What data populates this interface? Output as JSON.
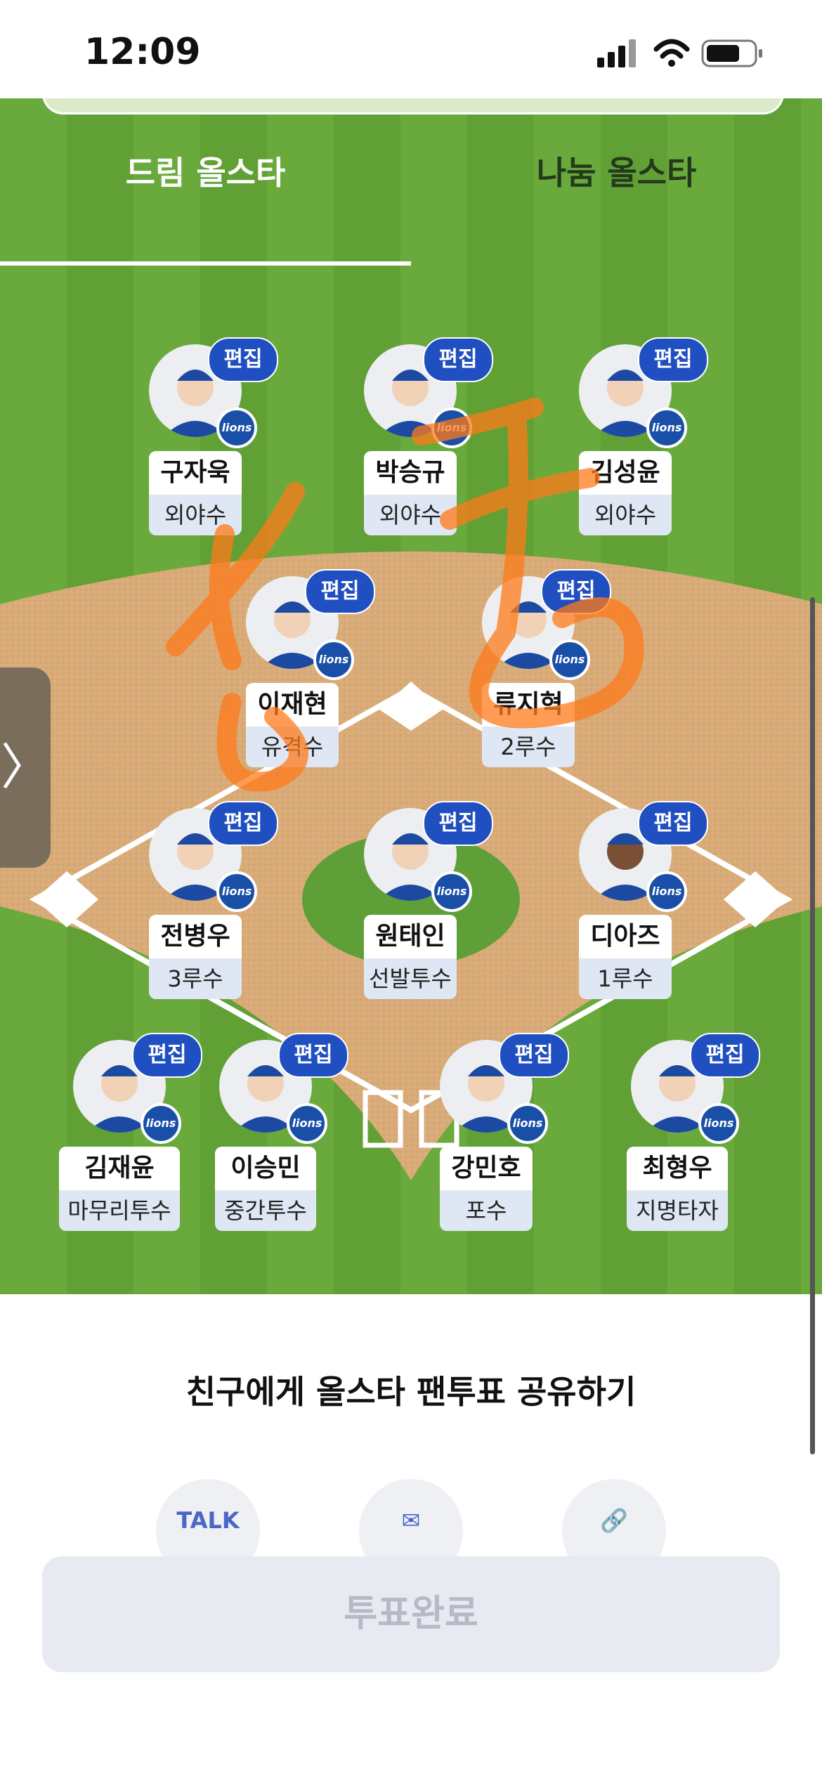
{
  "status_bar": {
    "time": "12:09"
  },
  "tabs": [
    {
      "label": "드림 올스타",
      "active": true
    },
    {
      "label": "나눔 올스타",
      "active": false
    }
  ],
  "edit_label": "편집",
  "team_logo_text": "lions",
  "players": [
    {
      "name": "구자욱",
      "position": "외야수"
    },
    {
      "name": "박승규",
      "position": "외야수"
    },
    {
      "name": "김성윤",
      "position": "외야수"
    },
    {
      "name": "이재현",
      "position": "유격수"
    },
    {
      "name": "류지혁",
      "position": "2루수"
    },
    {
      "name": "전병우",
      "position": "3루수"
    },
    {
      "name": "원태인",
      "position": "선발투수"
    },
    {
      "name": "디아즈",
      "position": "1루수"
    },
    {
      "name": "김재윤",
      "position": "마무리투수"
    },
    {
      "name": "이승민",
      "position": "중간투수"
    },
    {
      "name": "강민호",
      "position": "포수"
    },
    {
      "name": "최형우",
      "position": "지명타자"
    }
  ],
  "side_handle": "〉",
  "share": {
    "title": "친구에게 올스타 팬투표 공유하기",
    "buttons": [
      {
        "icon": "kakaotalk-icon",
        "label": "TALK"
      },
      {
        "icon": "mail-icon",
        "label": "✉"
      },
      {
        "icon": "link-icon",
        "label": "🔗"
      }
    ]
  },
  "vote_button": "투표완료",
  "colors": {
    "grass": "#6aaa3d",
    "dirt": "#d9ab78",
    "edit": "#1f4fc0",
    "scribble": "#ff7a1a"
  }
}
